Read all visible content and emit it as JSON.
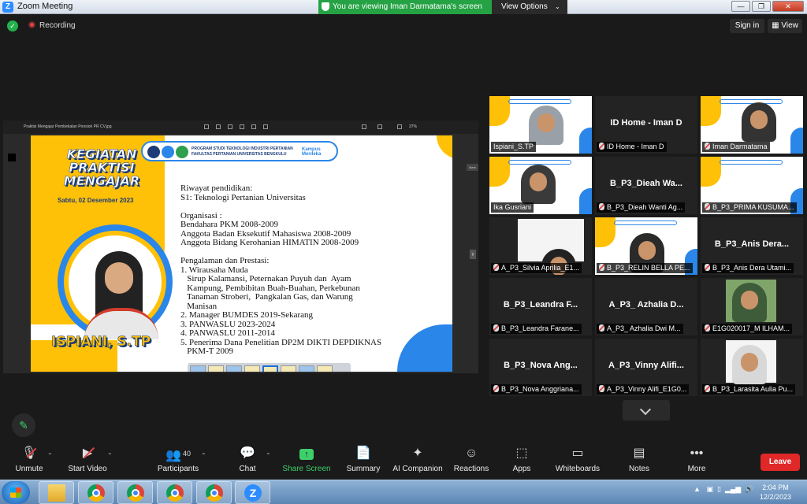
{
  "window": {
    "title": "Zoom Meeting",
    "viewing_banner": "You are viewing Iman Darmatama's screen",
    "view_options": "View Options",
    "minimize": "—",
    "maximize": "❐",
    "close": "✕"
  },
  "topbar": {
    "recording": "Recording",
    "sign_in": "Sign in",
    "view": "View"
  },
  "share": {
    "window_title": "Praktisi Mengajar Pembekalan Ponsiori PR CV.jpg",
    "zoom_level": "37%",
    "next_label": "Next",
    "slide": {
      "heading_lines": [
        "KEGIATAN",
        "PRAKTISI",
        "MENGAJAR"
      ],
      "date": "Sabtu, 02 Desember 2023",
      "banner_line1": "PROGRAM STUDI TEKNOLOGI INDUSTRI PERTANIAN",
      "banner_line2": "FAKULTAS PERTANIAN UNIVERSITAS BENGKULU",
      "banner_brand": "Kampus Merdeka",
      "name": "ISPIANI, S.TP",
      "body": "Riwayat pendidikan:\nS1: Teknologi Pertanian Universitas\n\nOrganisasi :\nBendahara PKM 2008-2009\nAnggota Badan Eksekutif Mahasiswa 2008-2009\nAnggota Bidang Kerohanian HIMATIN 2008-2009\n\nPengalaman dan Prestasi:\n1. Wirausaha Muda\n   Sirup Kalamansi, Peternakan Puyuh dan  Ayam\n   Kampung, Pembibitan Buah-Buahan, Perkebunan\n   Tanaman Stroberi,  Pangkalan Gas, dan Warung\n   Manisan\n2. Manager BUMDES 2019-Sekarang\n3. PANWASLU 2023-2024\n4. PANWASLU 2011-2014\n5. Penerima Dana Penelitian DP2M DIKTI DEPDIKNAS\n   PKM-T 2009"
    }
  },
  "participants": [
    {
      "display": "",
      "label": "Ispiani_S.TP",
      "muted": false,
      "video": true,
      "active": false
    },
    {
      "display": "ID Home - Iman D",
      "label": "ID Home - Iman D",
      "muted": true,
      "video": false,
      "active": false
    },
    {
      "display": "",
      "label": "Iman Darmatama",
      "muted": true,
      "video": true,
      "active": false
    },
    {
      "display": "",
      "label": "Ika Gusriani",
      "muted": false,
      "video": true,
      "active": true
    },
    {
      "display": "B_P3_Dieah Wa...",
      "label": "B_P3_Dieah Wanti Ag...",
      "muted": true,
      "video": false,
      "active": false
    },
    {
      "display": "",
      "label": "B_P3_PRIMA KUSUMA...",
      "muted": true,
      "video": true,
      "active": false
    },
    {
      "display": "",
      "label": "A_P3_Silvia Aprilia_E1...",
      "muted": true,
      "video": true,
      "active": false
    },
    {
      "display": "",
      "label": "B_P3_RELIN BELLA PE...",
      "muted": true,
      "video": true,
      "active": false
    },
    {
      "display": "B_P3_Anis Dera...",
      "label": "B_P3_Anis Dera Utami...",
      "muted": true,
      "video": false,
      "active": false
    },
    {
      "display": "B_P3_Leandra F...",
      "label": "B_P3_Leandra Farane...",
      "muted": true,
      "video": false,
      "active": false
    },
    {
      "display": "A_P3_ Azhalia D...",
      "label": "A_P3_ Azhalia Dwi M...",
      "muted": true,
      "video": false,
      "active": false
    },
    {
      "display": "",
      "label": "E1G020017_M ILHAM...",
      "muted": true,
      "video": true,
      "active": false
    },
    {
      "display": "B_P3_Nova Ang...",
      "label": "B_P3_Nova Anggriana...",
      "muted": true,
      "video": false,
      "active": false
    },
    {
      "display": "A_P3_Vinny Alifi...",
      "label": "A_P3_Vinny Alifi_E1G0...",
      "muted": true,
      "video": false,
      "active": false
    },
    {
      "display": "",
      "label": "B_P3_Larasita Aulia Pu...",
      "muted": true,
      "video": true,
      "active": false
    }
  ],
  "toolbar": {
    "unmute": "Unmute",
    "start_video": "Start Video",
    "participants": "Participants",
    "participants_count": "40",
    "chat": "Chat",
    "share_screen": "Share Screen",
    "summary": "Summary",
    "ai_companion": "AI Companion",
    "reactions": "Reactions",
    "apps": "Apps",
    "whiteboards": "Whiteboards",
    "notes": "Notes",
    "more": "More",
    "leave": "Leave"
  },
  "taskbar": {
    "time": "2:04 PM",
    "date": "12/2/2023"
  },
  "colors": {
    "zoom_blue": "#2d8cff",
    "banner_green": "#25a244",
    "leave_red": "#e02828",
    "active_speaker": "#a6e22e",
    "slide_yellow": "#ffc107",
    "slide_blue": "#2a86e8"
  }
}
